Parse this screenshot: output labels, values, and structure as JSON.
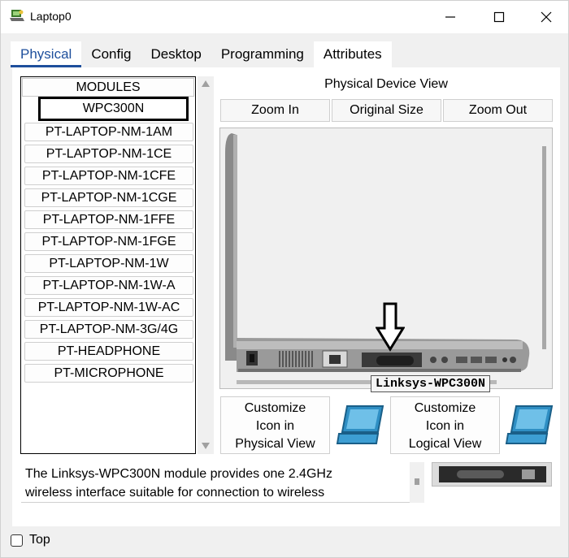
{
  "window": {
    "title": "Laptop0"
  },
  "tabs": [
    {
      "label": "Physical",
      "active": true
    },
    {
      "label": "Config"
    },
    {
      "label": "Desktop"
    },
    {
      "label": "Programming"
    },
    {
      "label": "Attributes"
    }
  ],
  "modules": {
    "header": "MODULES",
    "selected": "WPC300N",
    "items": [
      "WPC300N",
      "PT-LAPTOP-NM-1AM",
      "PT-LAPTOP-NM-1CE",
      "PT-LAPTOP-NM-1CFE",
      "PT-LAPTOP-NM-1CGE",
      "PT-LAPTOP-NM-1FFE",
      "PT-LAPTOP-NM-1FGE",
      "PT-LAPTOP-NM-1W",
      "PT-LAPTOP-NM-1W-A",
      "PT-LAPTOP-NM-1W-AC",
      "PT-LAPTOP-NM-3G/4G",
      "PT-HEADPHONE",
      "PT-MICROPHONE"
    ]
  },
  "device_view": {
    "title": "Physical Device View",
    "zoom_in": "Zoom In",
    "original_size": "Original Size",
    "zoom_out": "Zoom Out",
    "tooltip": "Linksys-WPC300N"
  },
  "customize": {
    "physical": [
      "Customize",
      "Icon in",
      "Physical View"
    ],
    "logical": [
      "Customize",
      "Icon in",
      "Logical View"
    ]
  },
  "description": {
    "line1": "The Linksys-WPC300N module provides one 2.4GHz",
    "line2": "wireless interface suitable for connection to wireless"
  },
  "footer": {
    "top_label": "Top",
    "top_checked": false
  },
  "icons": {
    "app": "packet-tracer-laptop-icon",
    "minimize": "minimize-icon",
    "maximize": "maximize-icon",
    "close": "close-icon",
    "laptop": "laptop-icon",
    "arrow": "down-arrow-icon"
  },
  "colors": {
    "tab_accent": "#1e4f9c",
    "panel": "#ffffff",
    "chrome": "#f0f0f0",
    "laptop_icon": "#2f8fc4"
  }
}
